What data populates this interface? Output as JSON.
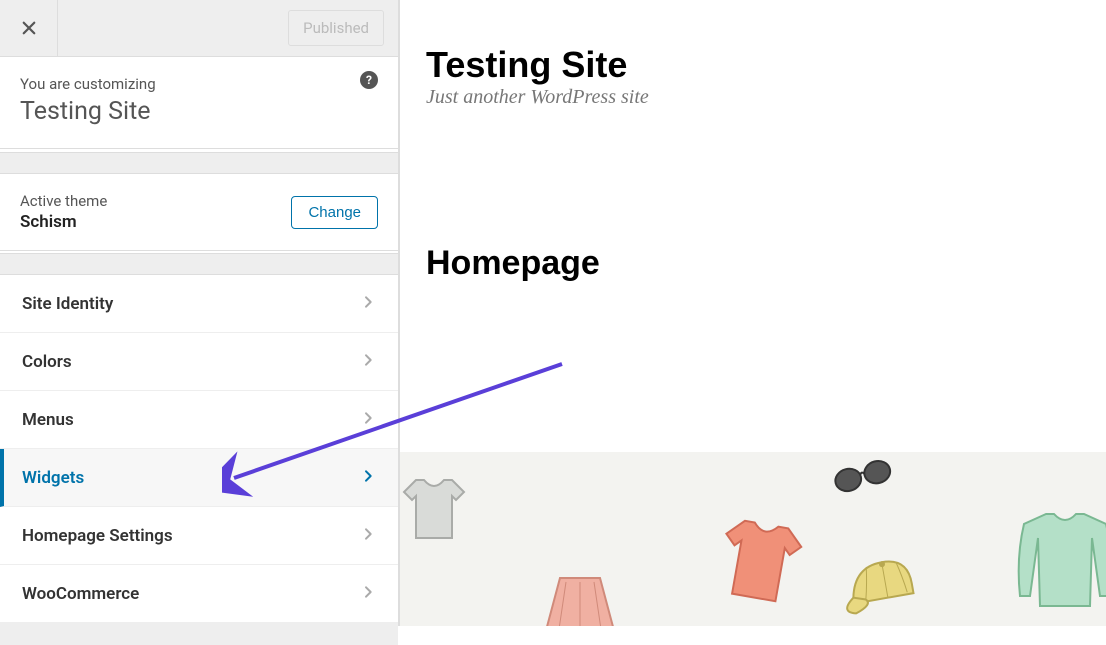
{
  "topbar": {
    "status": "Published"
  },
  "header": {
    "customizing_label": "You are customizing",
    "site_name": "Testing Site"
  },
  "theme": {
    "label": "Active theme",
    "name": "Schism",
    "change_btn": "Change"
  },
  "menu": {
    "items": [
      {
        "label": "Site Identity",
        "active": false
      },
      {
        "label": "Colors",
        "active": false
      },
      {
        "label": "Menus",
        "active": false
      },
      {
        "label": "Widgets",
        "active": true
      },
      {
        "label": "Homepage Settings",
        "active": false
      },
      {
        "label": "WooCommerce",
        "active": false
      }
    ]
  },
  "preview": {
    "site_title": "Testing Site",
    "tagline": "Just another WordPress site",
    "page_title": "Homepage"
  }
}
